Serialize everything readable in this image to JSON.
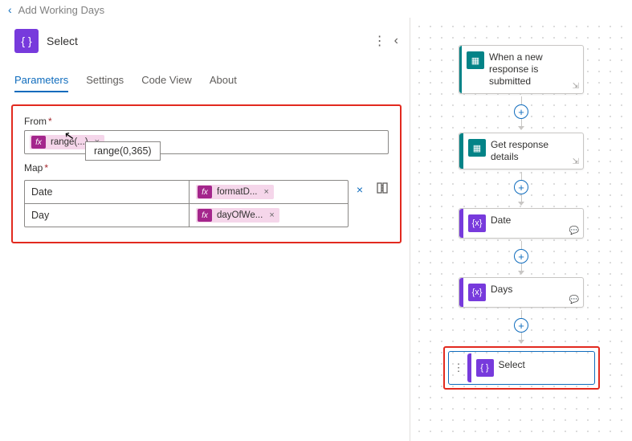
{
  "header": {
    "title": "Add Working Days"
  },
  "panel": {
    "icon": "{ }",
    "title": "Select",
    "tabs": [
      "Parameters",
      "Settings",
      "Code View",
      "About"
    ],
    "active_tab": 0
  },
  "form": {
    "from_label": "From",
    "from_token": "range(...)",
    "from_tooltip": "range(0,365)",
    "map_label": "Map",
    "map_rows": [
      {
        "key": "Date",
        "val_token": "formatD..."
      },
      {
        "key": "Day",
        "val_token": "dayOfWe..."
      }
    ]
  },
  "flow": {
    "plus": "+",
    "cards": [
      {
        "kind": "teal",
        "icon": "▦",
        "text": "When a new response is submitted",
        "corner": "⇲"
      },
      {
        "kind": "teal",
        "icon": "▦",
        "text": "Get response details",
        "corner": "⇲"
      },
      {
        "kind": "purple",
        "icon": "{x}",
        "text": "Date",
        "corner": "💬"
      },
      {
        "kind": "purple",
        "icon": "{x}",
        "text": "Days",
        "corner": "💬"
      },
      {
        "kind": "purple",
        "icon": "{ }",
        "text": "Select",
        "corner": "",
        "selected": true
      }
    ]
  }
}
